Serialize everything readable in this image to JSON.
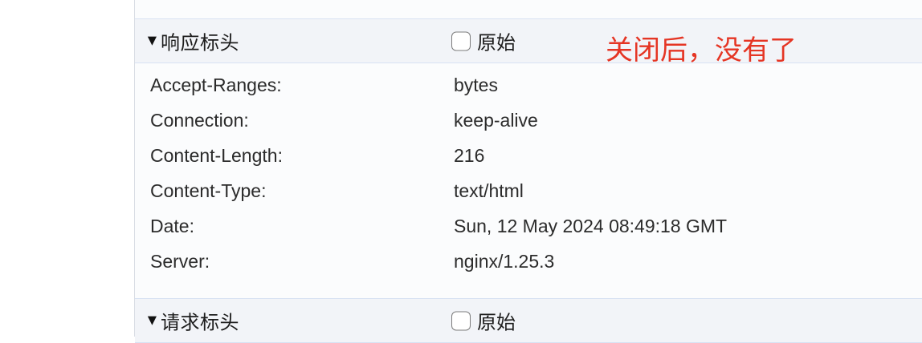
{
  "response_headers_section": {
    "triangle": "▼",
    "title": "响应标头",
    "raw_label": "原始",
    "raw_checked": false,
    "annotation": "关闭后，没有了",
    "annotation_color": "#e53524",
    "rows": [
      {
        "name": "Accept-Ranges:",
        "value": "bytes"
      },
      {
        "name": "Connection:",
        "value": "keep-alive"
      },
      {
        "name": "Content-Length:",
        "value": "216"
      },
      {
        "name": "Content-Type:",
        "value": "text/html"
      },
      {
        "name": "Date:",
        "value": "Sun, 12 May 2024 08:49:18 GMT"
      },
      {
        "name": "Server:",
        "value": "nginx/1.25.3"
      }
    ]
  },
  "request_headers_section": {
    "triangle": "▼",
    "title": "请求标头",
    "raw_label": "原始",
    "raw_checked": false
  }
}
